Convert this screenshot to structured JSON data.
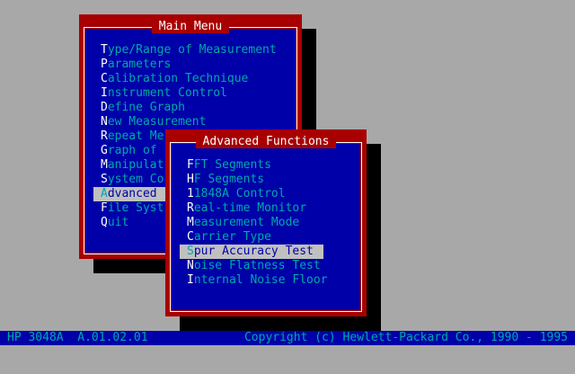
{
  "main_menu": {
    "title": "Main Menu",
    "items": [
      {
        "hot": "T",
        "rest": "ype/Range of Measurement"
      },
      {
        "hot": "P",
        "rest": "arameters"
      },
      {
        "hot": "C",
        "rest": "alibration Technique"
      },
      {
        "hot": "I",
        "rest": "nstrument Control"
      },
      {
        "hot": "D",
        "rest": "efine Graph"
      },
      {
        "hot": "N",
        "rest": "ew Measurement"
      },
      {
        "hot": "R",
        "rest": "epeat Me"
      },
      {
        "hot": "G",
        "rest": "raph of"
      },
      {
        "hot": "M",
        "rest": "anipulat"
      },
      {
        "hot": "S",
        "rest": "ystem Co"
      },
      {
        "hot": "A",
        "rest": "dvanced"
      },
      {
        "hot": "F",
        "rest": "ile Syst"
      },
      {
        "hot": "Q",
        "rest": "uit"
      }
    ],
    "selected_index": 10
  },
  "advanced_menu": {
    "title": "Advanced Functions",
    "items": [
      {
        "hot": "F",
        "rest": "FT Segments"
      },
      {
        "hot": "H",
        "rest": "F Segments"
      },
      {
        "hot": "1",
        "rest": "1848A Control"
      },
      {
        "hot": "R",
        "rest": "eal-time Monitor"
      },
      {
        "hot": "M",
        "rest": "easurement Mode"
      },
      {
        "hot": "C",
        "rest": "arrier Type"
      },
      {
        "hot": "S",
        "rest": "pur Accuracy Test"
      },
      {
        "hot": "N",
        "rest": "oise Flatness Test"
      },
      {
        "hot": "I",
        "rest": "nternal Noise Floor"
      }
    ],
    "selected_index": 6
  },
  "statusbar": {
    "product": "HP 3048A  A.01.02.01",
    "copyright": "Copyright (c) Hewlett-Packard Co., 1990 - 1995"
  },
  "colors": {
    "desktop": "#a8a8a8",
    "window_frame": "#a80000",
    "window_body": "#0000a8",
    "item_text": "#00a8a8",
    "hotkey": "#ffffff",
    "highlight": "#c0c0c0"
  }
}
